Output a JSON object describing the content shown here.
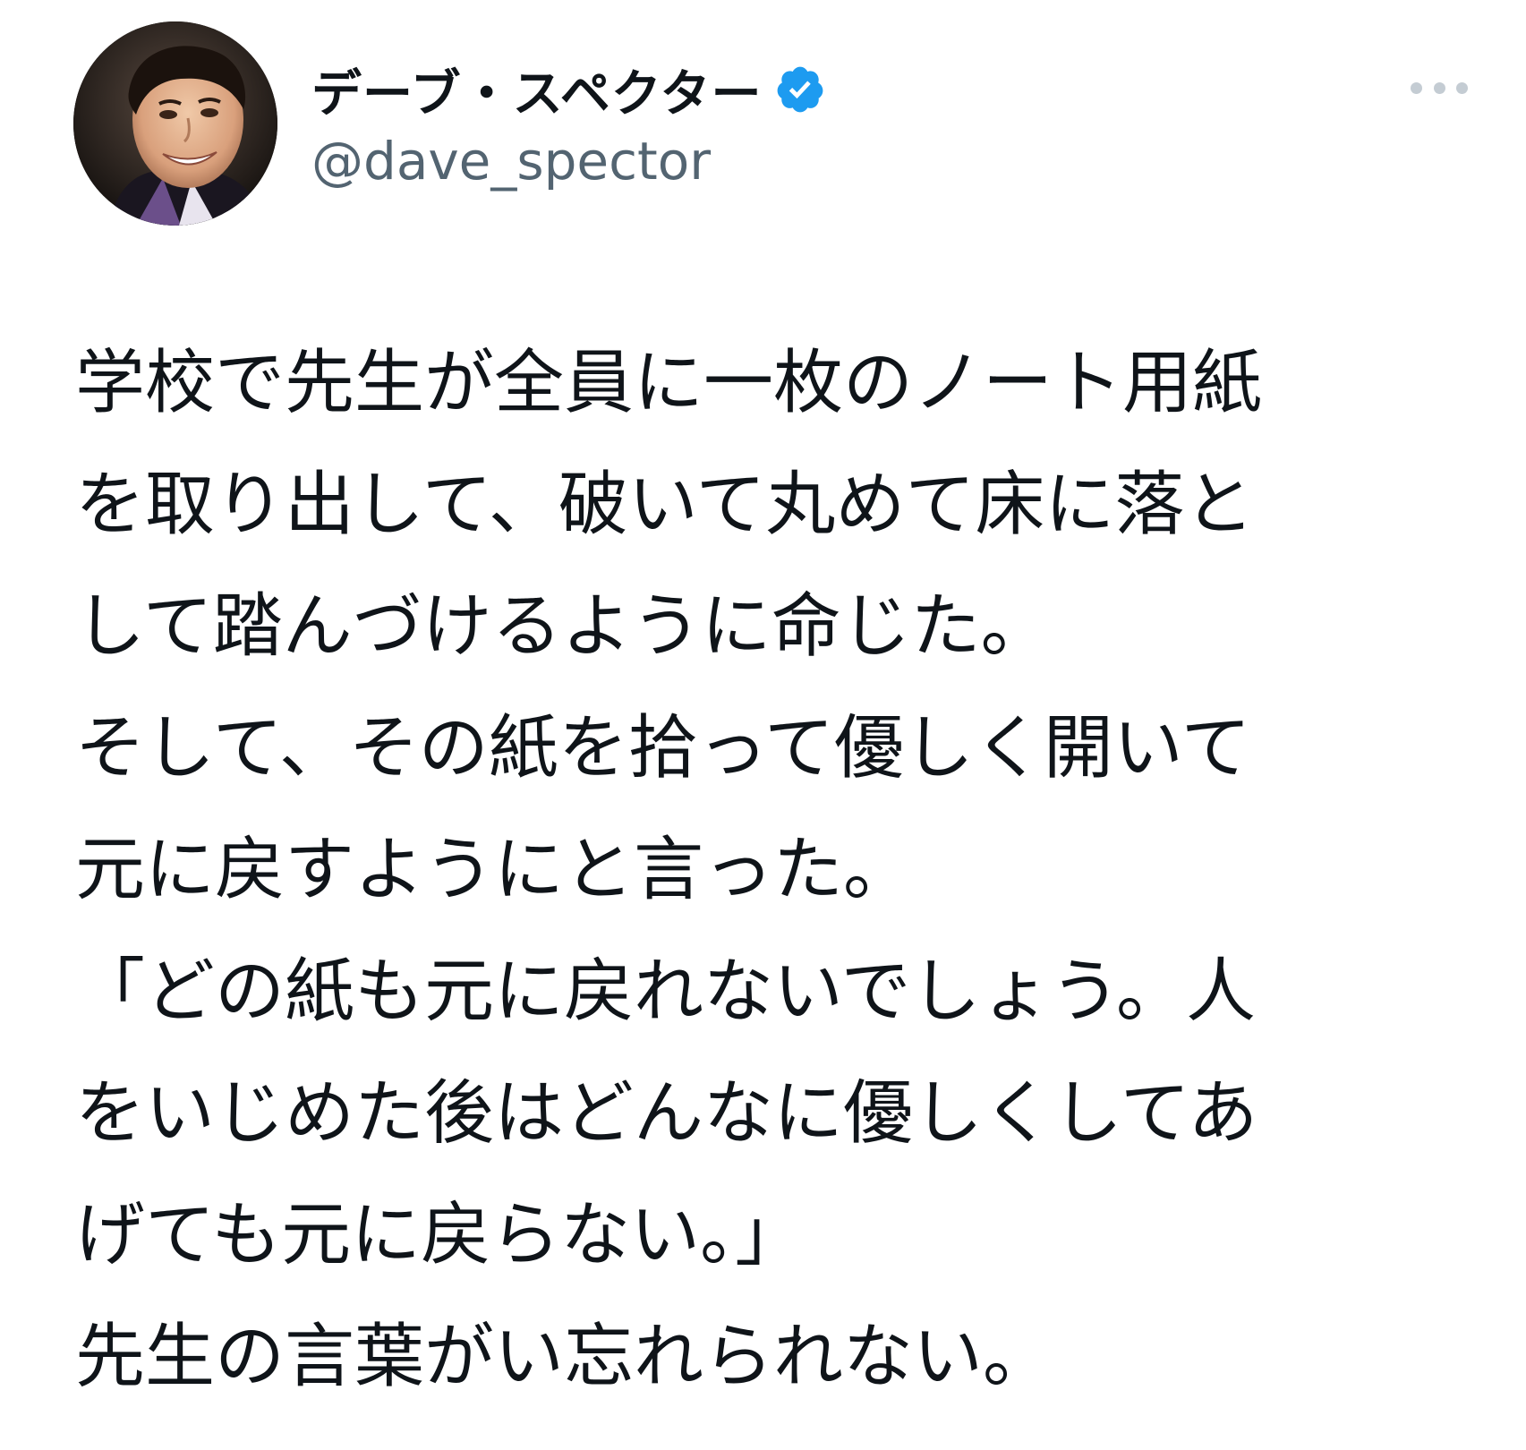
{
  "author": {
    "display_name": "デーブ・スペクター",
    "handle": "@dave_spector",
    "verified": true,
    "avatar_alt": "avatar"
  },
  "actions": {
    "more_icon": "more-horizontal-icon"
  },
  "tweet": {
    "lines": [
      "学校で先生が全員に一枚のノート用紙",
      "を取り出して、破いて丸めて床に落と",
      "して踏んづけるように命じた。",
      "そして、その紙を拾って優しく開いて",
      "元に戻すようにと言った。",
      "「どの紙も元に戻れないでしょう。人",
      "をいじめた後はどんなに優しくしてあ",
      "げても元に戻らない。」",
      "先生の言葉がい忘れられない。"
    ]
  },
  "colors": {
    "text_primary": "#0f1419",
    "text_secondary": "#536471",
    "verified_blue": "#1d9bf0",
    "more_dots": "#c4ccd3",
    "background": "#ffffff"
  }
}
